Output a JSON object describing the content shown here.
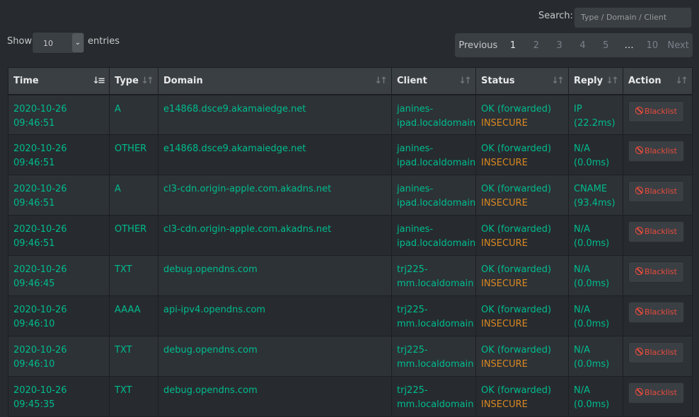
{
  "search": {
    "label": "Search:",
    "placeholder": "Type / Domain / Client"
  },
  "length": {
    "show_label": "Show",
    "value": "10",
    "entries_label": "entries"
  },
  "pagination": {
    "previous": "Previous",
    "pages": [
      "1",
      "2",
      "3",
      "4",
      "5"
    ],
    "ellipsis": "…",
    "last": "10",
    "next": "Next",
    "active": "1"
  },
  "columns": [
    "Time",
    "Type",
    "Domain",
    "Client",
    "Status",
    "Reply",
    "Action"
  ],
  "rows": [
    {
      "time": "2020-10-26 09:46:51",
      "type": "A",
      "domain": "e14868.dsce9.akamaiedge.net",
      "client1": "janines-",
      "client2": "ipad.localdomain",
      "status": "OK (forwarded)",
      "dnssec": "INSECURE",
      "reply1": "IP",
      "reply2": "(22.2ms)",
      "action": "Blacklist"
    },
    {
      "time": "2020-10-26 09:46:51",
      "type": "OTHER",
      "domain": "e14868.dsce9.akamaiedge.net",
      "client1": "janines-",
      "client2": "ipad.localdomain",
      "status": "OK (forwarded)",
      "dnssec": "INSECURE",
      "reply1": "N/A",
      "reply2": "(0.0ms)",
      "action": "Blacklist"
    },
    {
      "time": "2020-10-26 09:46:51",
      "type": "A",
      "domain": "cl3-cdn.origin-apple.com.akadns.net",
      "client1": "janines-",
      "client2": "ipad.localdomain",
      "status": "OK (forwarded)",
      "dnssec": "INSECURE",
      "reply1": "CNAME",
      "reply2": "(93.4ms)",
      "action": "Blacklist"
    },
    {
      "time": "2020-10-26 09:46:51",
      "type": "OTHER",
      "domain": "cl3-cdn.origin-apple.com.akadns.net",
      "client1": "janines-",
      "client2": "ipad.localdomain",
      "status": "OK (forwarded)",
      "dnssec": "INSECURE",
      "reply1": "N/A",
      "reply2": "(0.0ms)",
      "action": "Blacklist"
    },
    {
      "time": "2020-10-26 09:46:45",
      "type": "TXT",
      "domain": "debug.opendns.com",
      "client1": "trj225-",
      "client2": "mm.localdomain",
      "status": "OK (forwarded)",
      "dnssec": "INSECURE",
      "reply1": "N/A",
      "reply2": "(0.0ms)",
      "action": "Blacklist"
    },
    {
      "time": "2020-10-26 09:46:10",
      "type": "AAAA",
      "domain": "api-ipv4.opendns.com",
      "client1": "trj225-",
      "client2": "mm.localdomain",
      "status": "OK (forwarded)",
      "dnssec": "INSECURE",
      "reply1": "N/A",
      "reply2": "(0.0ms)",
      "action": "Blacklist"
    },
    {
      "time": "2020-10-26 09:46:10",
      "type": "TXT",
      "domain": "debug.opendns.com",
      "client1": "trj225-",
      "client2": "mm.localdomain",
      "status": "OK (forwarded)",
      "dnssec": "INSECURE",
      "reply1": "N/A",
      "reply2": "(0.0ms)",
      "action": "Blacklist"
    },
    {
      "time": "2020-10-26 09:45:35",
      "type": "TXT",
      "domain": "debug.opendns.com",
      "client1": "trj225-",
      "client2": "mm.localdomain",
      "status": "OK (forwarded)",
      "dnssec": "INSECURE",
      "reply1": "N/A",
      "reply2": "(0.0ms)",
      "action": "Blacklist"
    }
  ],
  "colors": {
    "background": "#272b30",
    "ok": "#00bc8c",
    "insecure": "#d98820",
    "blacklist": "#e74c3c"
  }
}
